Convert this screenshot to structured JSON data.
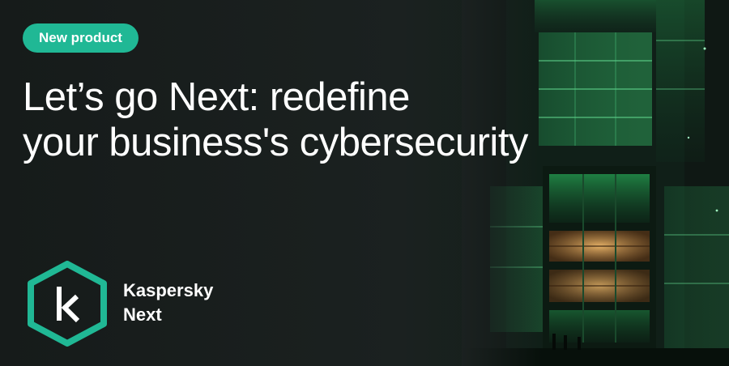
{
  "badge": {
    "label": "New product"
  },
  "headline": {
    "line1": "Let’s go Next: redefine",
    "line2": "your business's cybersecurity"
  },
  "brand": {
    "logo_icon": "kaspersky-k-hexagon-icon",
    "name_line1": "Kaspersky",
    "name_line2": "Next"
  },
  "colors": {
    "background": "#1a1f1e",
    "accent": "#20b895",
    "glow_green": "#2fd36a",
    "warm_light": "#e0a35a",
    "text": "#ffffff"
  },
  "illustration": {
    "subject": "glowing-glass-tower-building"
  }
}
